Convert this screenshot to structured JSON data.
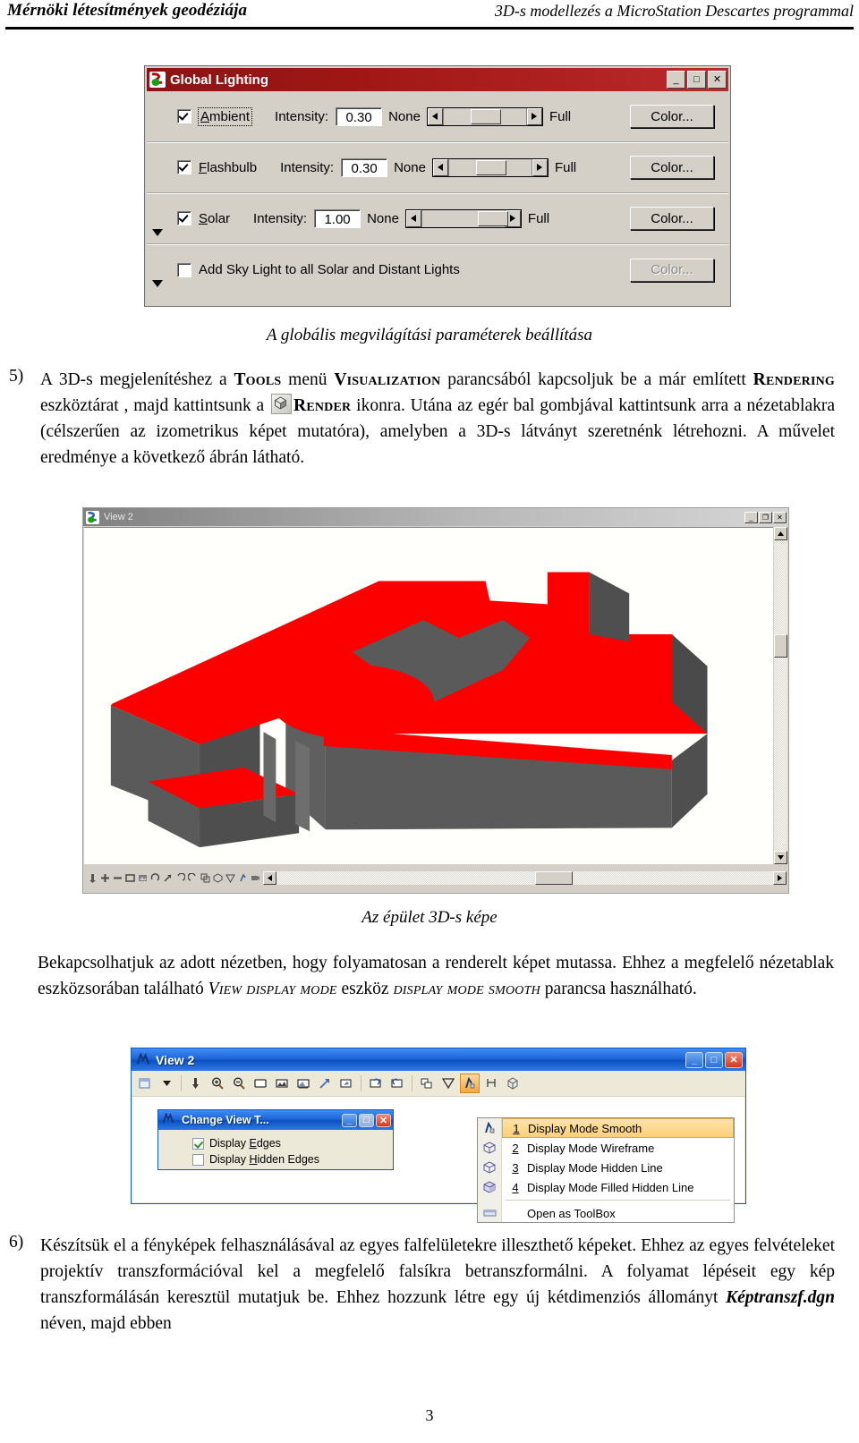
{
  "header": {
    "left": "Mérnöki létesítmények geodéziája",
    "right": "3D-s modellezés a MicroStation Descartes programmal"
  },
  "global_lighting": {
    "title": "Global Lighting",
    "window_buttons": {
      "minimize": "_",
      "maximize": "□",
      "close": "✕"
    },
    "rows": [
      {
        "checked": true,
        "label": "Ambient",
        "mnemonic": "A",
        "intensity_label": "Intensity:",
        "intensity_value": "0.30",
        "min_label": "None",
        "max_label": "Full",
        "slider_percent": 30,
        "color_label": "Color...",
        "color_disabled": false,
        "focused": true
      },
      {
        "checked": true,
        "label": "Flashbulb",
        "mnemonic": "F",
        "intensity_label": "Intensity:",
        "intensity_value": "0.30",
        "min_label": "None",
        "max_label": "Full",
        "slider_percent": 30,
        "color_label": "Color...",
        "color_disabled": false,
        "focused": false
      },
      {
        "checked": true,
        "label": "Solar",
        "mnemonic": "S",
        "intensity_label": "Intensity:",
        "intensity_value": "1.00",
        "min_label": "None",
        "max_label": "Full",
        "slider_percent": 68,
        "color_label": "Color...",
        "color_disabled": false,
        "focused": false
      }
    ],
    "skylight": {
      "checked": false,
      "label": "Add Sky Light to all Solar and Distant Lights",
      "color_label": "Color...",
      "color_disabled": true
    }
  },
  "caption1": "A globális megvilágítási paraméterek beállítása",
  "step5": {
    "number": "5)",
    "line1_a": "A 3D-s megjelenítéshez a ",
    "tools": "Tools",
    "line1_b": " menü ",
    "visualization": "Visualization",
    "line1_c": " parancsából kapcsoljuk be a már",
    "line2_a": "említett ",
    "rendering": "Rendering",
    "line2_b": " eszköztárat , majd kattintsunk a ",
    "render": "Render",
    "line2_c": " ikonra. Utána az egér",
    "line3": "bal gombjával kattintsunk arra a nézetablakra (célszerűen az izometrikus képet mutatóra),",
    "line4": "amelyben a 3D-s látványt szeretnénk létrehozni. A művelet eredménye a következő ábrán",
    "line5": "látható."
  },
  "view2_render": {
    "title": "View 2",
    "window_buttons": {
      "minimize": "_",
      "restore": "❐",
      "close": "✕"
    },
    "toolbar_icons": [
      "update-view-icon",
      "zoom-in-icon",
      "zoom-out-icon",
      "window-area-icon",
      "fit-view-icon",
      "rotate-view-icon",
      "pan-view-icon",
      "view-previous-icon",
      "view-next-icon",
      "copy-view-icon",
      "clip-volume-icon",
      "clip-mask-icon",
      "display-mode-icon",
      "camera-icon",
      "render-icon"
    ],
    "model": {
      "body_color": "#5a5a5a",
      "roof_color": "#fc0000",
      "background": "#fffffc"
    }
  },
  "caption2": "Az épület 3D-s képe",
  "para_middle": {
    "line1": "Bekapcsolhatjuk az adott nézetben, hogy folyamatosan a renderelt képet mutassa. Ehhez",
    "line2_a": "a megfelelő nézetablak eszközsorában található ",
    "view_display_mode": "View display mode",
    "line2_b": " eszköz ",
    "display_mode_smooth": "display mode smooth",
    "line2_c": " parancsa használható."
  },
  "view2_xp": {
    "title": "View 2",
    "window_buttons": {
      "minimize": "_",
      "maximize": "□",
      "close": "✕"
    },
    "toolbar_icons": [
      "view-attributes-icon",
      "dropdown-arrow-icon",
      "update-view-icon",
      "zoom-in-icon",
      "zoom-out-icon",
      "window-area-icon",
      "fit-view-icon",
      "render-view-icon",
      "rotate-view-icon",
      "pan-view-icon",
      "view-previous-icon",
      "view-next-icon",
      "copy-view-icon",
      "clip-volume-icon",
      "display-mode-icon",
      "change-view-perspective-icon",
      "camera-icon"
    ]
  },
  "change_view_tool": {
    "title": "Change View T...",
    "window_buttons": {
      "minimize": "_",
      "maximize": "□",
      "close": "✕"
    },
    "options": [
      {
        "label": "Display Edges",
        "mnemonic": "E",
        "checked": true
      },
      {
        "label": "Display Hidden Edges",
        "mnemonic": "H",
        "checked": false
      }
    ]
  },
  "display_mode_menu": {
    "items": [
      {
        "key": "1",
        "label": "Display Mode Smooth",
        "icon": "display-mode-smooth-icon",
        "highlighted": true
      },
      {
        "key": "2",
        "label": "Display Mode Wireframe",
        "icon": "display-mode-wireframe-icon",
        "highlighted": false
      },
      {
        "key": "3",
        "label": "Display Mode Hidden Line",
        "icon": "display-mode-hidden-line-icon",
        "highlighted": false
      },
      {
        "key": "4",
        "label": "Display Mode Filled Hidden Line",
        "icon": "display-mode-filled-hidden-line-icon",
        "highlighted": false
      }
    ],
    "footer": {
      "label": "Open as ToolBox",
      "icon": "toolbox-icon"
    }
  },
  "step6": {
    "number": "6)",
    "line1": "Készítsük el a fényképek felhasználásával az egyes falfelületekre illeszthető képeket.",
    "line2": "Ehhez az egyes felvételeket projektív transzformációval kel a megfelelő falsíkra",
    "line3": "betranszformálni. A folyamat lépéseit egy kép transzformálásán keresztül mutatjuk be.",
    "line4_a": "Ehhez hozzunk létre egy új kétdimenziós állományt ",
    "filename": "Képtranszf.dgn",
    "line4_b": " néven, majd ebben"
  },
  "page_number": "3"
}
